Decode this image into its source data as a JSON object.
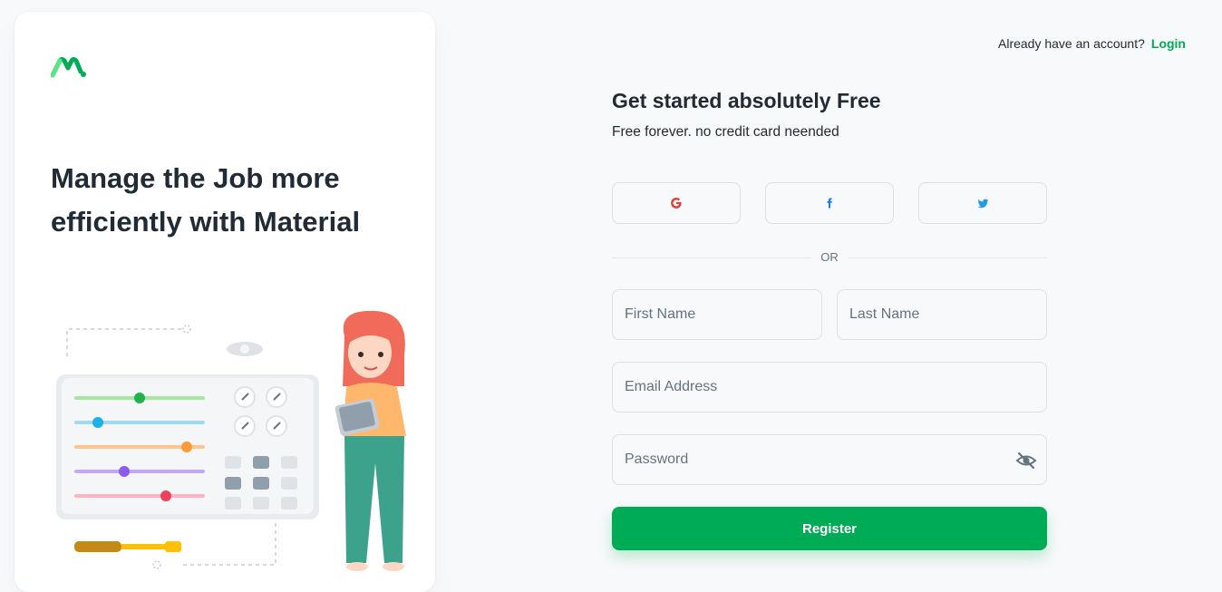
{
  "left_panel": {
    "heading": "Manage the Job more efficiently with Material"
  },
  "header": {
    "login_prompt": "Already have an account?",
    "login_link": "Login"
  },
  "form": {
    "title": "Get started absolutely Free",
    "subtitle": "Free forever. no credit card neended",
    "divider": "OR",
    "first_name_placeholder": "First Name",
    "last_name_placeholder": "Last Name",
    "email_placeholder": "Email Address",
    "password_placeholder": "Password",
    "register_label": "Register"
  },
  "social": [
    {
      "icon": "google-icon",
      "color": "#df3e30"
    },
    {
      "icon": "facebook-icon",
      "color": "#1877f2"
    },
    {
      "icon": "twitter-icon",
      "color": "#1c9cea"
    }
  ],
  "colors": {
    "primary": "#00ab55",
    "text": "#212b36",
    "muted": "#637381",
    "border": "#dce0e4"
  }
}
